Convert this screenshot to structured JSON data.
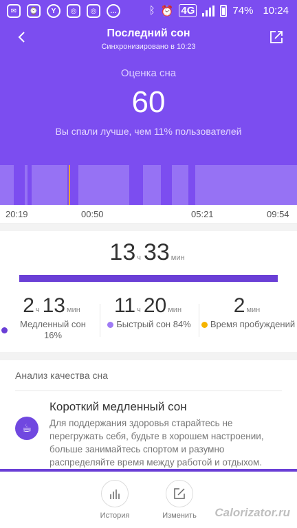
{
  "status_bar": {
    "battery": "74%",
    "time": "10:24",
    "network": "4G"
  },
  "header": {
    "title": "Последний сон",
    "subtitle": "Синхронизировано в 10:23"
  },
  "score": {
    "label": "Оценка сна",
    "value": "60",
    "comparison": "Вы спали лучше, чем 11% пользователей"
  },
  "time_axis": [
    "20:19",
    "00:50",
    "05:21",
    "09:54"
  ],
  "total": {
    "hours": "13",
    "hours_unit": "ч",
    "minutes": "33",
    "minutes_unit": "мин"
  },
  "stats": {
    "slow": {
      "hours": "2",
      "minutes": "13",
      "h_unit": "ч",
      "m_unit": "мин",
      "label": "Медленный сон",
      "percent": "16%"
    },
    "fast": {
      "hours": "11",
      "minutes": "20",
      "h_unit": "ч",
      "m_unit": "мин",
      "label": "Быстрый сон 84%"
    },
    "awake": {
      "minutes": "2",
      "m_unit": "мин",
      "label": "Время пробуждений"
    }
  },
  "analysis": {
    "section_title": "Анализ качества сна",
    "tip_title": "Короткий медленный сон",
    "tip_body": "Для поддержания здоровья старайтесь не перегружать себя, будьте в хорошем настроении, больше занимайтесь спортом и разумно распределяйте время между работой и отдыхом."
  },
  "bottom_nav": {
    "history": "История",
    "edit": "Изменить"
  },
  "watermark": "Calorizator.ru",
  "colors": {
    "primary": "#7c4df0",
    "deep_sleep": "#7c4df0",
    "light_sleep": "#9672f4",
    "slow_dot": "#6a3fd6",
    "fast_dot": "#9f7bf5",
    "awake_dot": "#f5b400"
  }
}
